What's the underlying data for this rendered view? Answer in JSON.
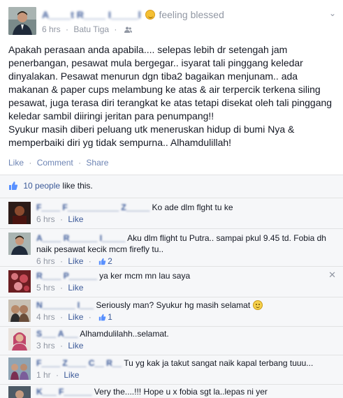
{
  "post": {
    "author": "A____t R____ I_____l",
    "feeling": "feeling blessed",
    "time": "6 hrs",
    "location": "Batu Tiga",
    "privacy_icon": "friends-icon",
    "body": "Apakah perasaan anda apabila.... selepas lebih dr setengah jam\npenerbangan, pesawat mula bergegar.. isyarat tali pinggang keledar\ndinyalakan. Pesawat menurun dgn tiba2 bagaikan menjunam.. ada\nmakanan & paper cups melambung ke atas & air terpercik terkena siling\npesawat, juga terasa diri terangkat ke atas tetapi disekat oleh tali pinggang\nkeledar sambil diiringi jeritan para penumpang!!\nSyukur masih diberi peluang utk meneruskan hidup di bumi Nya &\nmemperbaiki diri yg tidak sempurna.. Alhamdulillah!",
    "actions": {
      "like": "Like",
      "comment": "Comment",
      "share": "Share"
    }
  },
  "likes": {
    "count_link": "10 people",
    "suffix": "like this."
  },
  "comments": [
    {
      "name": "F____ F___________ Z_____",
      "text": "Ko ade dlm flght tu ke",
      "time": "6 hrs",
      "like": "Like",
      "like_count": ""
    },
    {
      "name": "A____ R______ I_____",
      "text": "Aku dlm flight tu ",
      "mention": "Putra",
      "text_after": ".. sampai pkul 9.45 td. Fobia dh",
      "text_line2": "naik pesawat kecik mcm firefly tu..",
      "time": "6 hrs",
      "like": "Like",
      "like_count": "2"
    },
    {
      "name": "R____ P______",
      "text": "ya ker mcm mn lau saya",
      "time": "5 hrs",
      "like": "Like",
      "like_count": ""
    },
    {
      "name": "N_______ I___",
      "text": "Seriously man? Syukur hg masih selamat",
      "time": "4 hrs",
      "like": "Like",
      "like_count": "1"
    },
    {
      "name": "S___ A___",
      "text": "Alhamdulilahh..selamat.",
      "time": "3 hrs",
      "like": "Like",
      "like_count": ""
    },
    {
      "name": "F____ Z____ C__ R__",
      "text": "Tu yg kak ja takut sangat naik kapal terbang tuuu...",
      "time": "1 hr",
      "like": "Like",
      "like_count": ""
    },
    {
      "name": "K___ F______",
      "text": "Very the....!!! Hope u x fobia sgt la..lepas ni yer",
      "time": "",
      "like": "",
      "like_count": ""
    }
  ],
  "colors": {
    "link": "#3b5998",
    "muted": "#9197a3",
    "ufi_bg": "#f6f7f9"
  }
}
